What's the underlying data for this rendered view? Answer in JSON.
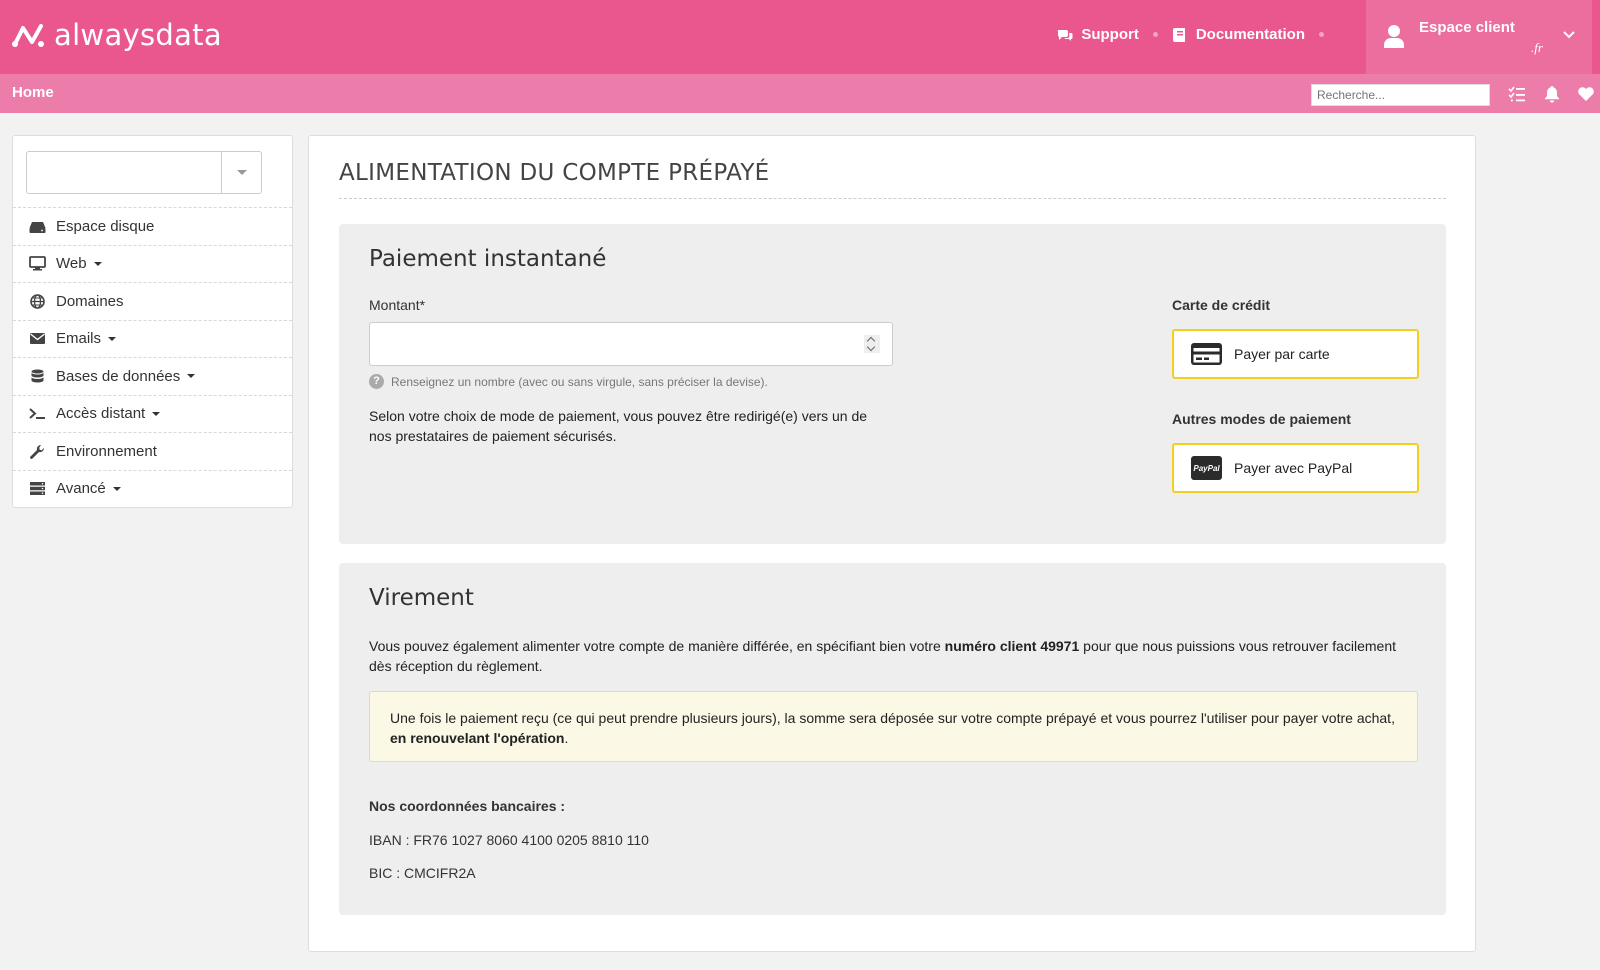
{
  "header": {
    "logo_text": "alwaysdata",
    "support_label": "Support",
    "documentation_label": "Documentation",
    "account_label": "Espace client",
    "account_sub": ".fr"
  },
  "subbar": {
    "home_label": "Home",
    "search_placeholder": "Recherche..."
  },
  "sidebar": {
    "items": [
      {
        "label": "Espace disque",
        "icon": "hard-drive-icon",
        "dropdown": false
      },
      {
        "label": "Web",
        "icon": "monitor-icon",
        "dropdown": true
      },
      {
        "label": "Domaines",
        "icon": "globe-icon",
        "dropdown": false
      },
      {
        "label": "Emails",
        "icon": "envelope-icon",
        "dropdown": true
      },
      {
        "label": "Bases de données",
        "icon": "database-icon",
        "dropdown": true
      },
      {
        "label": "Accès distant",
        "icon": "terminal-icon",
        "dropdown": true
      },
      {
        "label": "Environnement",
        "icon": "wrench-icon",
        "dropdown": false
      },
      {
        "label": "Avancé",
        "icon": "server-icon",
        "dropdown": true
      }
    ]
  },
  "main": {
    "title": "ALIMENTATION DU COMPTE PRÉPAYÉ",
    "instant": {
      "heading": "Paiement instantané",
      "amount_label": "Montant*",
      "amount_value": "",
      "help_text": "Renseignez un nombre (avec ou sans virgule, sans préciser la devise).",
      "redirect_text": "Selon votre choix de mode de paiement, vous pouvez être redirigé(e) vers un de nos prestataires de paiement sécurisés.",
      "card_heading": "Carte de crédit",
      "card_button": "Payer par carte",
      "other_heading": "Autres modes de paiement",
      "paypal_button": "Payer avec PayPal",
      "paypal_icon_text": "PayPal"
    },
    "transfer": {
      "heading": "Virement",
      "text_before": "Vous pouvez également alimenter votre compte de manière différée, en spécifiant bien votre ",
      "text_bold": "numéro client 49971",
      "text_after": " pour que nous puissions vous retrouver facilement dès réception du règlement.",
      "notice_before": "Une fois le paiement reçu (ce qui peut prendre plusieurs jours), la somme sera déposée sur votre compte prépayé et vous pourrez l'utiliser pour payer votre achat, ",
      "notice_bold": "en renouvelant l'opération",
      "notice_after": ".",
      "bank_heading": "Nos coordonnées bancaires :",
      "iban": "IBAN : FR76 1027 8060 4100 0205 8810 110",
      "bic": "BIC : CMCIFR2A"
    }
  },
  "colors": {
    "header_bg": "#e9578e",
    "subbar_bg": "#ec7caa",
    "button_border": "#f5cf1e"
  }
}
